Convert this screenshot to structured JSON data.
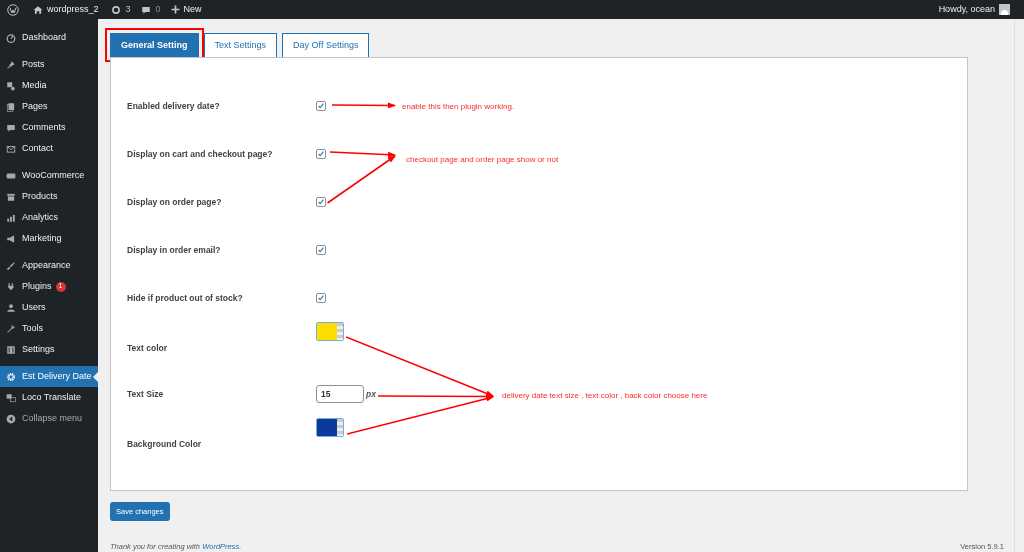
{
  "admin_bar": {
    "site": "wordpress_2",
    "updates": "3",
    "comments": "0",
    "new": "New",
    "greeting": "Howdy, ocean"
  },
  "sidebar": {
    "groups": [
      [
        {
          "label": "Dashboard",
          "selected": false
        }
      ],
      [
        {
          "label": "Posts",
          "selected": false
        },
        {
          "label": "Media",
          "selected": false
        },
        {
          "label": "Pages",
          "selected": false
        },
        {
          "label": "Comments",
          "selected": false
        },
        {
          "label": "Contact",
          "selected": false
        }
      ],
      [
        {
          "label": "WooCommerce",
          "selected": false
        },
        {
          "label": "Products",
          "selected": false
        },
        {
          "label": "Analytics",
          "selected": false
        },
        {
          "label": "Marketing",
          "selected": false
        }
      ],
      [
        {
          "label": "Appearance",
          "selected": false
        },
        {
          "label": "Plugins",
          "selected": false,
          "badge": "1"
        },
        {
          "label": "Users",
          "selected": false
        },
        {
          "label": "Tools",
          "selected": false
        },
        {
          "label": "Settings",
          "selected": false
        }
      ],
      [
        {
          "label": "Est Delivery Date",
          "selected": true
        },
        {
          "label": "Loco Translate",
          "selected": false
        }
      ]
    ],
    "collapse": "Collapse menu"
  },
  "tabs": [
    {
      "label": "General Setting",
      "selected": true
    },
    {
      "label": "Text Settings",
      "selected": false
    },
    {
      "label": "Day Off Settings",
      "selected": false
    }
  ],
  "settings": [
    {
      "kind": "checkbox",
      "label": "Enabled delivery date?",
      "checked": true
    },
    {
      "kind": "checkbox",
      "label": "Display on cart and checkout page?",
      "checked": true
    },
    {
      "kind": "checkbox",
      "label": "Display on order page?",
      "checked": true
    },
    {
      "kind": "checkbox",
      "label": "Display in order email?",
      "checked": true
    },
    {
      "kind": "checkbox",
      "label": "Hide if product out of stock?",
      "checked": true
    },
    {
      "kind": "color",
      "label": "Text color",
      "color": "#ffdd00"
    },
    {
      "kind": "number",
      "label": "Text Size",
      "value": "15",
      "unit": "px"
    },
    {
      "kind": "color",
      "label": "Background Color",
      "color": "#0a3a9a"
    }
  ],
  "annotations": [
    "enable this then plugin working.",
    "checkout page and order page  show or not",
    "delivery date  text size , text color , back color choose here"
  ],
  "save_button": "Save changes",
  "footer": {
    "text_before": "Thank you for creating with",
    "link": "WordPress",
    "text_after": ".",
    "version": "Version 5.9.1"
  }
}
